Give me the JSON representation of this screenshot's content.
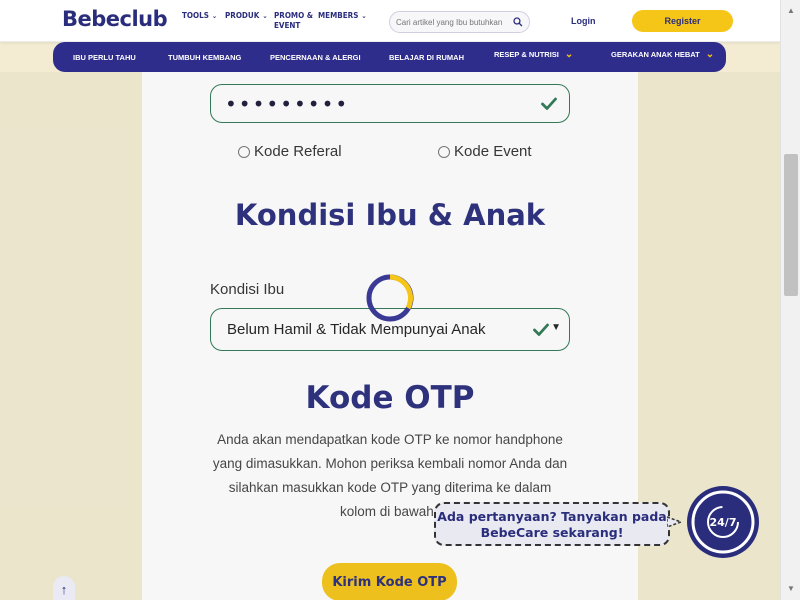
{
  "header": {
    "logo": "Bebeclub",
    "nav": [
      {
        "label": "TOOLS",
        "has_dropdown": true
      },
      {
        "label": "PRODUK",
        "has_dropdown": true
      },
      {
        "label": "PROMO &",
        "label2": "EVENT",
        "has_dropdown": false
      },
      {
        "label": "MEMBERS",
        "has_dropdown": true
      }
    ],
    "search_placeholder": "Cari artikel yang Ibu butuhkan",
    "login_label": "Login",
    "register_label": "Register"
  },
  "categories": [
    {
      "label": "IBU PERLU TAHU",
      "has_dropdown": false
    },
    {
      "label": "TUMBUH KEMBANG",
      "has_dropdown": false
    },
    {
      "label": "PENCERNAAN & ALERGI",
      "has_dropdown": false
    },
    {
      "label": "BELAJAR DI RUMAH",
      "has_dropdown": false
    },
    {
      "label": "RESEP & NUTRISI",
      "has_dropdown": true
    },
    {
      "label": "GERAKAN ANAK HEBAT",
      "has_dropdown": true
    }
  ],
  "form": {
    "password_value": "•••••••••",
    "radio_referal": "Kode Referal",
    "radio_event": "Kode Event",
    "section_kondisi": "Kondisi Ibu & Anak",
    "kondisi_label": "Kondisi Ibu",
    "kondisi_value": "Belum Hamil & Tidak Mempunyai Anak",
    "section_otp": "Kode OTP",
    "otp_lines": [
      "Anda akan mendapatkan kode OTP ke nomor handphone",
      "yang dimasukkan. Mohon periksa kembali nomor Anda dan",
      "silahkan masukkan kode OTP yang diterima ke dalam",
      "kolom di bawah"
    ],
    "kirim_label": "Kirim Kode OTP"
  },
  "chat": {
    "line1": "Ada pertanyaan? Tanyakan pada",
    "line2": "BebeCare sekarang!",
    "badge": "24/7"
  },
  "colors": {
    "brand_navy": "#2a2d7c",
    "brand_yellow": "#f5c518",
    "field_green": "#2f7a55",
    "background": "#f3ecd2"
  }
}
